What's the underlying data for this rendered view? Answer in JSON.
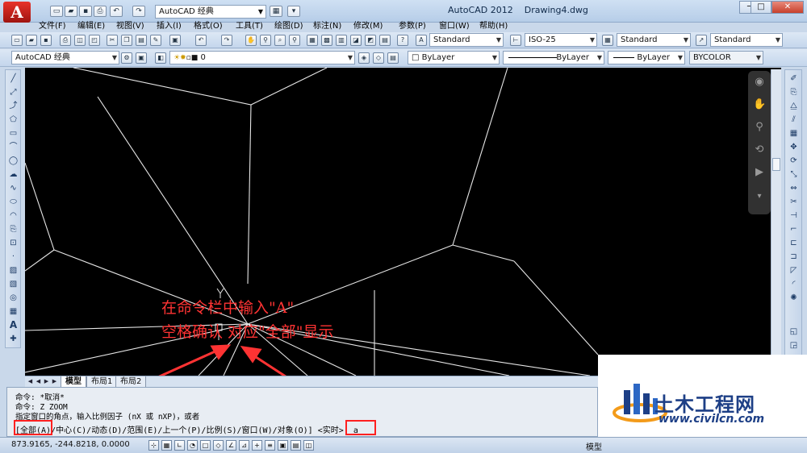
{
  "titlebar": {
    "logo_letter": "A",
    "workspace": "AutoCAD 经典",
    "app_title": "AutoCAD 2012",
    "doc_title": "Drawing4.dwg",
    "minimize": "─",
    "restore": "□",
    "close": "✕"
  },
  "menu": [
    "文件(F)",
    "编辑(E)",
    "视图(V)",
    "插入(I)",
    "格式(O)",
    "工具(T)",
    "绘图(D)",
    "标注(N)",
    "修改(M)",
    "参数(P)",
    "窗口(W)",
    "帮助(H)"
  ],
  "toolbar": {
    "text_style": "Standard",
    "dim_style": "ISO-25",
    "table_style": "Standard",
    "multileader_style": "Standard",
    "workspace2": "AutoCAD 经典",
    "layer": "0",
    "color": "ByLayer",
    "linetype": "ByLayer",
    "lineweight": "ByLayer",
    "plotstyle": "BYCOLOR"
  },
  "tabs": {
    "model": "模型",
    "layout1": "布局1",
    "layout2": "布局2"
  },
  "command": {
    "line1": "命令: *取消*",
    "line2": "命令: Z ZOOM",
    "line3": "指定窗口的角点，输入比例因子 (nX 或 nXP)，或者",
    "prompt_all": "[全部(A)",
    "prompt_rest": "/中心(C)/动态(D)/范围(E)/上一个(P)/比例(S)/窗口(W)/对象(O)] <实时>:",
    "input_value": "a"
  },
  "status": {
    "coordinates": "873.9165,  -244.8218, 0.0000",
    "model_label": "模型"
  },
  "annotation": {
    "line1": "在命令栏中输入\"A\"",
    "line2": "空格确认 对应\"全部\"显示",
    "color": "#ff3333"
  },
  "watermark": {
    "title": "土木工程网",
    "url": "www.civilcn.com"
  }
}
